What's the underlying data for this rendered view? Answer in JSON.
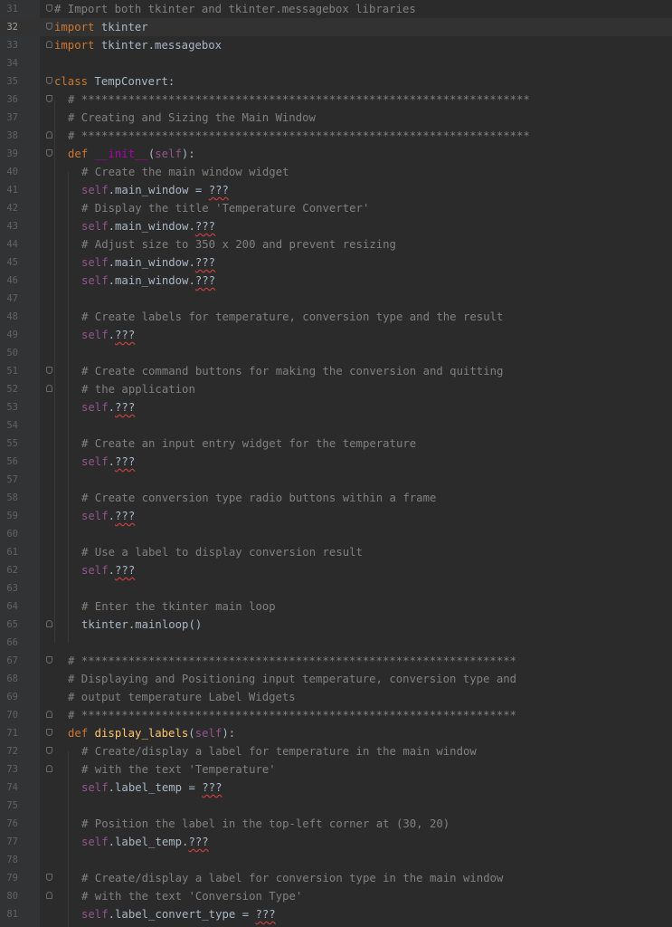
{
  "editor": {
    "current_line": 32,
    "lines": [
      {
        "n": "31",
        "indent": 0,
        "fold": "start",
        "tokens": [
          {
            "t": "c",
            "v": "# Import both tkinter and tkinter.messagebox libraries"
          }
        ]
      },
      {
        "n": "32",
        "indent": 0,
        "fold": "start",
        "tokens": [
          {
            "t": "k",
            "v": "import"
          },
          {
            "t": "p",
            "v": " tkinter"
          }
        ]
      },
      {
        "n": "33",
        "indent": 0,
        "fold": "end",
        "tokens": [
          {
            "t": "k",
            "v": "import"
          },
          {
            "t": "p",
            "v": " tkinter.messagebox"
          }
        ]
      },
      {
        "n": "34",
        "indent": 0,
        "tokens": []
      },
      {
        "n": "35",
        "indent": 0,
        "fold": "start",
        "tokens": [
          {
            "t": "k",
            "v": "class"
          },
          {
            "t": "p",
            "v": " TempConvert:"
          }
        ]
      },
      {
        "n": "36",
        "indent": 1,
        "fold": "start",
        "tokens": [
          {
            "t": "c",
            "v": "# *******************************************************************"
          }
        ]
      },
      {
        "n": "37",
        "indent": 1,
        "tokens": [
          {
            "t": "c",
            "v": "# Creating and Sizing the Main Window"
          }
        ]
      },
      {
        "n": "38",
        "indent": 1,
        "fold": "end",
        "tokens": [
          {
            "t": "c",
            "v": "# *******************************************************************"
          }
        ]
      },
      {
        "n": "39",
        "indent": 1,
        "fold": "start",
        "tokens": [
          {
            "t": "k",
            "v": "def"
          },
          {
            "t": "p",
            "v": " "
          },
          {
            "t": "mg",
            "v": "__init__"
          },
          {
            "t": "p",
            "v": "("
          },
          {
            "t": "s",
            "v": "self"
          },
          {
            "t": "p",
            "v": "):"
          }
        ]
      },
      {
        "n": "40",
        "indent": 2,
        "tokens": [
          {
            "t": "c",
            "v": "# Create the main window widget"
          }
        ]
      },
      {
        "n": "41",
        "indent": 2,
        "tokens": [
          {
            "t": "s",
            "v": "self"
          },
          {
            "t": "p",
            "v": ".main_window = "
          },
          {
            "t": "q",
            "v": "???"
          }
        ]
      },
      {
        "n": "42",
        "indent": 2,
        "tokens": [
          {
            "t": "c",
            "v": "# Display the title 'Temperature Converter'"
          }
        ]
      },
      {
        "n": "43",
        "indent": 2,
        "tokens": [
          {
            "t": "s",
            "v": "self"
          },
          {
            "t": "p",
            "v": ".main_window."
          },
          {
            "t": "q",
            "v": "???"
          }
        ]
      },
      {
        "n": "44",
        "indent": 2,
        "tokens": [
          {
            "t": "c",
            "v": "# Adjust size to 350 x 200 and prevent resizing"
          }
        ]
      },
      {
        "n": "45",
        "indent": 2,
        "tokens": [
          {
            "t": "s",
            "v": "self"
          },
          {
            "t": "p",
            "v": ".main_window."
          },
          {
            "t": "q",
            "v": "???"
          }
        ]
      },
      {
        "n": "46",
        "indent": 2,
        "tokens": [
          {
            "t": "s",
            "v": "self"
          },
          {
            "t": "p",
            "v": ".main_window."
          },
          {
            "t": "q",
            "v": "???"
          }
        ]
      },
      {
        "n": "47",
        "indent": 2,
        "tokens": []
      },
      {
        "n": "48",
        "indent": 2,
        "tokens": [
          {
            "t": "c",
            "v": "# Create labels for temperature, conversion type and the result"
          }
        ]
      },
      {
        "n": "49",
        "indent": 2,
        "tokens": [
          {
            "t": "s",
            "v": "self"
          },
          {
            "t": "p",
            "v": "."
          },
          {
            "t": "q",
            "v": "???"
          }
        ]
      },
      {
        "n": "50",
        "indent": 2,
        "tokens": []
      },
      {
        "n": "51",
        "indent": 2,
        "fold": "start",
        "tokens": [
          {
            "t": "c",
            "v": "# Create command buttons for making the conversion and quitting"
          }
        ]
      },
      {
        "n": "52",
        "indent": 2,
        "fold": "end",
        "tokens": [
          {
            "t": "c",
            "v": "# the application"
          }
        ]
      },
      {
        "n": "53",
        "indent": 2,
        "tokens": [
          {
            "t": "s",
            "v": "self"
          },
          {
            "t": "p",
            "v": "."
          },
          {
            "t": "q",
            "v": "???"
          }
        ]
      },
      {
        "n": "54",
        "indent": 2,
        "tokens": []
      },
      {
        "n": "55",
        "indent": 2,
        "tokens": [
          {
            "t": "c",
            "v": "# Create an input entry widget for the temperature"
          }
        ]
      },
      {
        "n": "56",
        "indent": 2,
        "tokens": [
          {
            "t": "s",
            "v": "self"
          },
          {
            "t": "p",
            "v": "."
          },
          {
            "t": "q",
            "v": "???"
          }
        ]
      },
      {
        "n": "57",
        "indent": 2,
        "tokens": []
      },
      {
        "n": "58",
        "indent": 2,
        "tokens": [
          {
            "t": "c",
            "v": "# Create conversion type radio buttons within a frame"
          }
        ]
      },
      {
        "n": "59",
        "indent": 2,
        "tokens": [
          {
            "t": "s",
            "v": "self"
          },
          {
            "t": "p",
            "v": "."
          },
          {
            "t": "q",
            "v": "???"
          }
        ]
      },
      {
        "n": "60",
        "indent": 2,
        "tokens": []
      },
      {
        "n": "61",
        "indent": 2,
        "tokens": [
          {
            "t": "c",
            "v": "# Use a label to display conversion result"
          }
        ]
      },
      {
        "n": "62",
        "indent": 2,
        "tokens": [
          {
            "t": "s",
            "v": "self"
          },
          {
            "t": "p",
            "v": "."
          },
          {
            "t": "q",
            "v": "???"
          }
        ]
      },
      {
        "n": "63",
        "indent": 2,
        "tokens": []
      },
      {
        "n": "64",
        "indent": 2,
        "tokens": [
          {
            "t": "c",
            "v": "# Enter the tkinter main loop"
          }
        ]
      },
      {
        "n": "65",
        "indent": 2,
        "fold": "end",
        "tokens": [
          {
            "t": "p",
            "v": "tkinter.mainloop()"
          }
        ]
      },
      {
        "n": "66",
        "indent": 0,
        "tokens": []
      },
      {
        "n": "67",
        "indent": 1,
        "fold": "start",
        "tokens": [
          {
            "t": "c",
            "v": "# *****************************************************************"
          }
        ]
      },
      {
        "n": "68",
        "indent": 1,
        "tokens": [
          {
            "t": "c",
            "v": "# Displaying and Positioning input temperature, conversion type and"
          }
        ]
      },
      {
        "n": "69",
        "indent": 1,
        "tokens": [
          {
            "t": "c",
            "v": "# output temperature Label Widgets"
          }
        ]
      },
      {
        "n": "70",
        "indent": 1,
        "fold": "end",
        "tokens": [
          {
            "t": "c",
            "v": "# *****************************************************************"
          }
        ]
      },
      {
        "n": "71",
        "indent": 1,
        "fold": "start",
        "tokens": [
          {
            "t": "k",
            "v": "def"
          },
          {
            "t": "p",
            "v": " "
          },
          {
            "t": "fn",
            "v": "display_labels"
          },
          {
            "t": "p",
            "v": "("
          },
          {
            "t": "s",
            "v": "self"
          },
          {
            "t": "p",
            "v": "):"
          }
        ]
      },
      {
        "n": "72",
        "indent": 2,
        "fold": "start",
        "tokens": [
          {
            "t": "c",
            "v": "# Create/display a label for temperature in the main window"
          }
        ]
      },
      {
        "n": "73",
        "indent": 2,
        "fold": "end",
        "tokens": [
          {
            "t": "c",
            "v": "# with the text 'Temperature'"
          }
        ]
      },
      {
        "n": "74",
        "indent": 2,
        "tokens": [
          {
            "t": "s",
            "v": "self"
          },
          {
            "t": "p",
            "v": ".label_temp = "
          },
          {
            "t": "q",
            "v": "???"
          }
        ]
      },
      {
        "n": "75",
        "indent": 2,
        "tokens": []
      },
      {
        "n": "76",
        "indent": 2,
        "tokens": [
          {
            "t": "c",
            "v": "# Position the label in the top-left corner at (30, 20)"
          }
        ]
      },
      {
        "n": "77",
        "indent": 2,
        "tokens": [
          {
            "t": "s",
            "v": "self"
          },
          {
            "t": "p",
            "v": ".label_temp."
          },
          {
            "t": "q",
            "v": "???"
          }
        ]
      },
      {
        "n": "78",
        "indent": 2,
        "tokens": []
      },
      {
        "n": "79",
        "indent": 2,
        "fold": "start",
        "tokens": [
          {
            "t": "c",
            "v": "# Create/display a label for conversion type in the main window"
          }
        ]
      },
      {
        "n": "80",
        "indent": 2,
        "fold": "end",
        "tokens": [
          {
            "t": "c",
            "v": "# with the text 'Conversion Type'"
          }
        ]
      },
      {
        "n": "81",
        "indent": 2,
        "tokens": [
          {
            "t": "s",
            "v": "self"
          },
          {
            "t": "p",
            "v": ".label_convert_type = "
          },
          {
            "t": "q",
            "v": "???"
          }
        ]
      }
    ]
  }
}
